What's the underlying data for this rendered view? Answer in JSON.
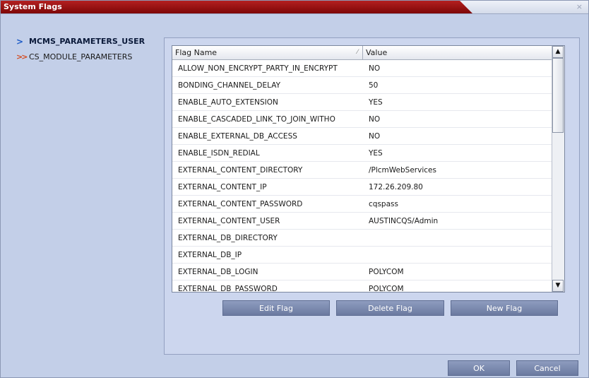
{
  "window": {
    "title": "System Flags",
    "close_glyph": "×"
  },
  "tree": {
    "items": [
      {
        "label": "MCMS_PARAMETERS_USER",
        "icon": "chevron-right-icon",
        "glyph": ">"
      },
      {
        "label": "CS_MODULE_PARAMETERS",
        "icon": "double-chevron-right-icon",
        "glyph": ">>"
      }
    ]
  },
  "grid": {
    "columns": {
      "name": "Flag Name",
      "value": "Value"
    },
    "sort_glyph": "⁄",
    "rows": [
      {
        "name": "ALLOW_NON_ENCRYPT_PARTY_IN_ENCRYPT",
        "value": "NO"
      },
      {
        "name": "BONDING_CHANNEL_DELAY",
        "value": "50"
      },
      {
        "name": "ENABLE_AUTO_EXTENSION",
        "value": "YES"
      },
      {
        "name": "ENABLE_CASCADED_LINK_TO_JOIN_WITHO",
        "value": "NO"
      },
      {
        "name": "ENABLE_EXTERNAL_DB_ACCESS",
        "value": "NO"
      },
      {
        "name": "ENABLE_ISDN_REDIAL",
        "value": "YES"
      },
      {
        "name": "EXTERNAL_CONTENT_DIRECTORY",
        "value": "/PlcmWebServices"
      },
      {
        "name": "EXTERNAL_CONTENT_IP",
        "value": "172.26.209.80"
      },
      {
        "name": "EXTERNAL_CONTENT_PASSWORD",
        "value": "cqspass"
      },
      {
        "name": "EXTERNAL_CONTENT_USER",
        "value": "AUSTINCQS/Admin"
      },
      {
        "name": "EXTERNAL_DB_DIRECTORY",
        "value": ""
      },
      {
        "name": "EXTERNAL_DB_IP",
        "value": ""
      },
      {
        "name": "EXTERNAL_DB_LOGIN",
        "value": "POLYCOM"
      },
      {
        "name": "EXTERNAL_DB_PASSWORD",
        "value": "POLYCOM"
      }
    ],
    "scroll_up_glyph": "▲",
    "scroll_down_glyph": "▼"
  },
  "buttons": {
    "edit": "Edit Flag",
    "delete": "Delete Flag",
    "new": "New Flag",
    "ok": "OK",
    "cancel": "Cancel"
  }
}
